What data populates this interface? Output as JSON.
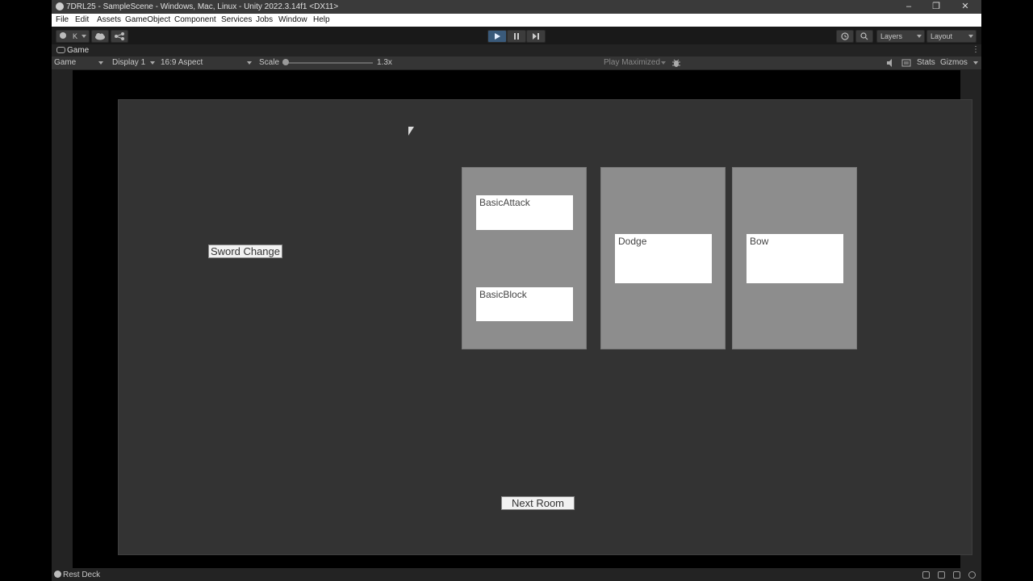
{
  "window": {
    "title": "7DRL25 - SampleScene - Windows, Mac, Linux - Unity 2022.3.14f1 <DX11>",
    "controls": {
      "minimize": "–",
      "restore": "❐",
      "close": "✕"
    }
  },
  "menu": [
    "File",
    "Edit",
    "Assets",
    "GameObject",
    "Component",
    "Services",
    "Jobs",
    "Window",
    "Help"
  ],
  "toolbar": {
    "account_label": "K",
    "layers_label": "Layers",
    "layout_label": "Layout",
    "icons": [
      "account-icon",
      "cloud-icon",
      "collab-icon",
      "play-icon",
      "pause-icon",
      "step-icon",
      "history-icon",
      "search-icon"
    ]
  },
  "tab": {
    "label": "Game"
  },
  "gamebar": {
    "view_select": "Game",
    "display_select": "Display 1",
    "aspect_select": "16:9 Aspect",
    "scale_label": "Scale",
    "scale_value": "1.3x",
    "scale_fraction": 0.0,
    "play_mode": "Play Maximized",
    "stats_label": "Stats",
    "gizmos_label": "Gizmos"
  },
  "game": {
    "sword_change_button": "Sword Change",
    "next_room_button": "Next Room",
    "panels": [
      {
        "cards": [
          "BasicAttack",
          "BasicBlock"
        ]
      },
      {
        "cards": [
          "Dodge"
        ]
      },
      {
        "cards": [
          "Bow"
        ]
      }
    ]
  },
  "status": {
    "message": "Rest Deck"
  },
  "colors": {
    "accent": "#3a5a7a",
    "canvas": "#333333",
    "panel": "#8d8d8d",
    "card": "#ffffff"
  }
}
